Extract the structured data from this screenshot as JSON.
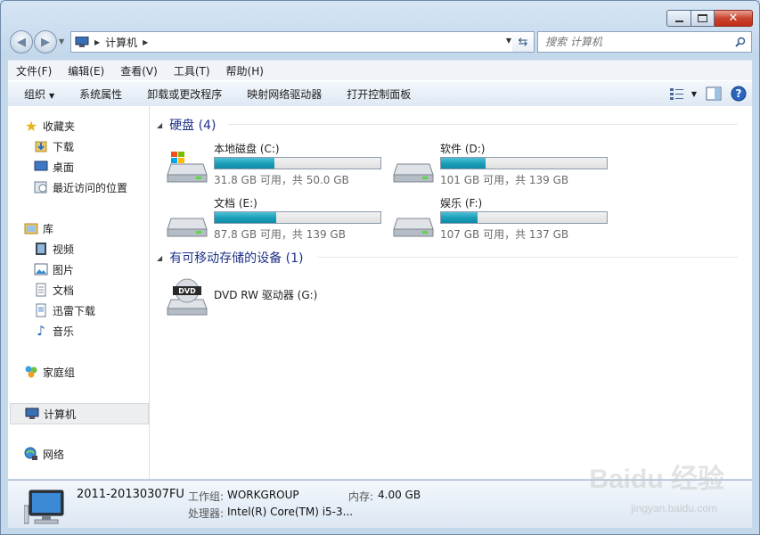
{
  "window": {
    "min_icon": "minimize-icon",
    "max_icon": "maximize-icon",
    "close_icon": "close-icon"
  },
  "address": {
    "crumb": "计算机"
  },
  "search": {
    "placeholder": "搜索 计算机"
  },
  "menu": [
    "文件(F)",
    "编辑(E)",
    "查看(V)",
    "工具(T)",
    "帮助(H)"
  ],
  "toolbar": {
    "organize": "组织",
    "sys_props": "系统属性",
    "uninstall": "卸载或更改程序",
    "map_drive": "映射网络驱动器",
    "control_panel": "打开控制面板"
  },
  "sidebar": {
    "favorites": "收藏夹",
    "downloads": "下载",
    "desktop": "桌面",
    "recent": "最近访问的位置",
    "libraries": "库",
    "videos": "视频",
    "pictures": "图片",
    "documents": "文档",
    "xunlei": "迅雷下载",
    "music": "音乐",
    "homegroup": "家庭组",
    "computer": "计算机",
    "network": "网络"
  },
  "groups": {
    "hdd": "硬盘 (4)",
    "removable": "有可移动存储的设备 (1)"
  },
  "drives": [
    {
      "name": "本地磁盘 (C:)",
      "free": "31.8 GB 可用，共 50.0 GB",
      "used_fraction": 0.36
    },
    {
      "name": "软件 (D:)",
      "free": "101 GB 可用，共 139 GB",
      "used_fraction": 0.27
    },
    {
      "name": "文档 (E:)",
      "free": "87.8 GB 可用，共 139 GB",
      "used_fraction": 0.37
    },
    {
      "name": "娱乐 (F:)",
      "free": "107 GB 可用，共 137 GB",
      "used_fraction": 0.22
    }
  ],
  "dvd": {
    "name": "DVD RW 驱动器 (G:)",
    "label": "DVD"
  },
  "details": {
    "computer_name": "2011-20130307FU",
    "workgroup_label": "工作组:",
    "workgroup": "WORKGROUP",
    "memory_label": "内存:",
    "memory": "4.00 GB",
    "cpu_label": "处理器:",
    "cpu": "Intel(R) Core(TM) i5-3..."
  },
  "watermark": {
    "brand": "Baidu 经验",
    "url": "jingyan.baidu.com"
  }
}
